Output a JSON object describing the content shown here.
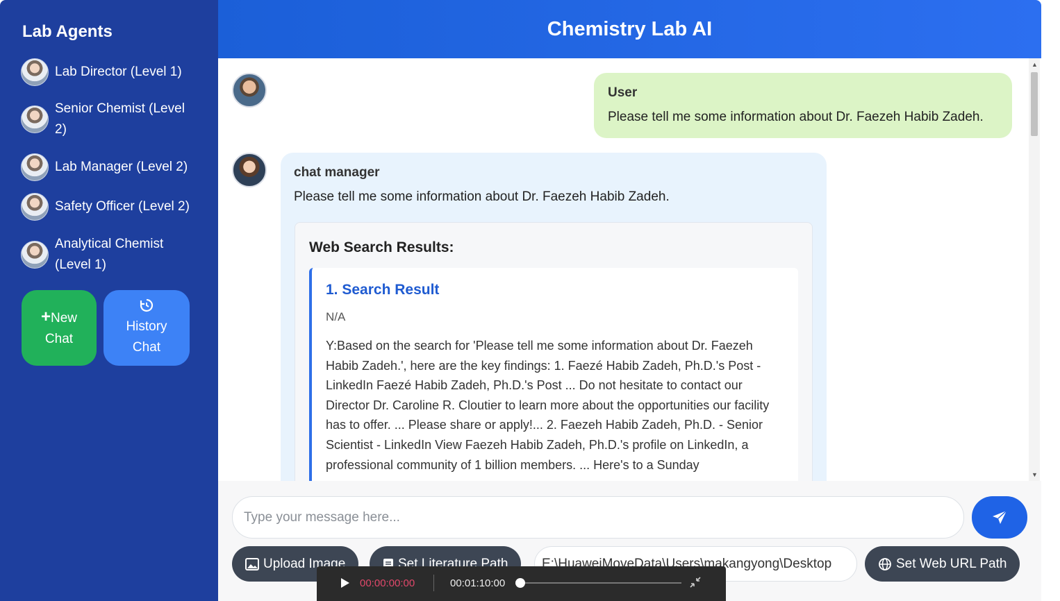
{
  "sidebar": {
    "title": "Lab Agents",
    "agents": [
      {
        "label": "Lab Director (Level 1)"
      },
      {
        "label": "Senior Chemist (Level 2)"
      },
      {
        "label": "Lab Manager (Level 2)"
      },
      {
        "label": "Safety Officer (Level 2)"
      },
      {
        "label": "Analytical Chemist (Level 1)"
      }
    ],
    "new_chat": {
      "icon": "plus-icon",
      "line1": "New",
      "line2": "Chat",
      "color": "#21b15a"
    },
    "history_chat": {
      "icon": "history-icon",
      "line1": "History",
      "line2": "Chat",
      "color": "#3d82f6"
    }
  },
  "header": {
    "title": "Chemistry Lab AI"
  },
  "messages": {
    "user": {
      "name": "User",
      "text": "Please tell me some information about Dr. Faezeh Habib Zadeh."
    },
    "bot": {
      "name": "chat manager",
      "text": "Please tell me some information about Dr. Faezeh Habib Zadeh.",
      "search": {
        "heading": "Web Search Results:",
        "result": {
          "title": "1. Search Result",
          "meta": "N/A",
          "body": "Y:Based on the search for 'Please tell me some information about Dr. Faezeh Habib Zadeh.', here are the key findings: 1. Faezé Habib Zadeh, Ph.D.'s Post - LinkedIn Faezé Habib Zadeh, Ph.D.'s Post ... Do not hesitate to contact our Director Dr. Caroline R. Cloutier to learn more about the opportunities our facility has to offer. ... Please share or apply!... 2. Faezeh Habib Zadeh, Ph.D. - Senior Scientist - LinkedIn View Faezeh Habib Zadeh, Ph.D.'s profile on LinkedIn, a professional community of 1 billion members. ... Here's to a Sunday"
        }
      }
    }
  },
  "footer": {
    "message_placeholder": "Type your message here...",
    "upload_image": "Upload Image",
    "set_literature_path": "Set Literature Path",
    "literature_path_value": "E:\\HuaweiMoveData\\Users\\makangyong\\Desktop",
    "set_web_url_path": "Set Web URL Path",
    "accent": "#1f63e6"
  },
  "player": {
    "current": "00:00:00:00",
    "total": "00:01:10:00",
    "progress": 0
  }
}
